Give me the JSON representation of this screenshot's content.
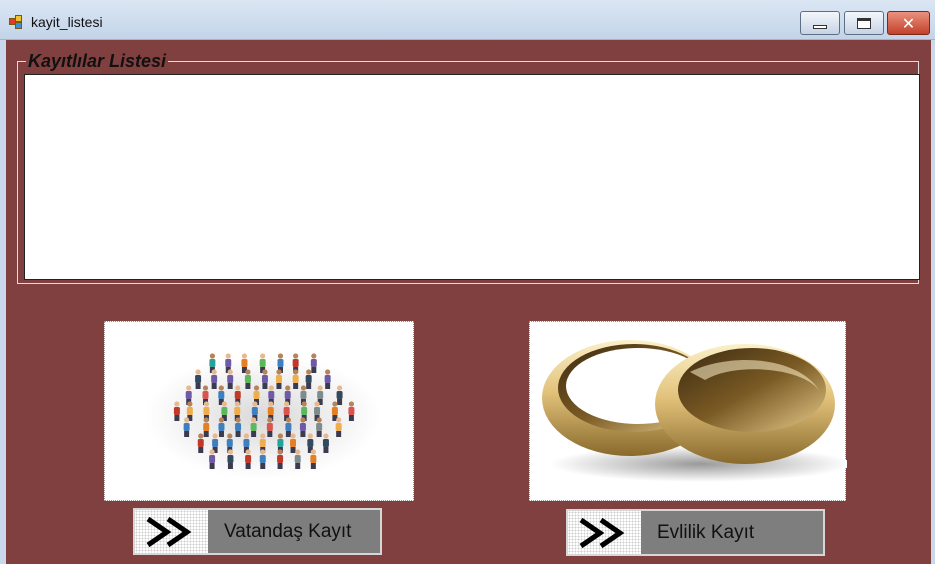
{
  "window": {
    "title": "kayit_listesi",
    "minimize_icon": "minimize-icon",
    "maximize_icon": "maximize-icon",
    "close_icon": "close-icon",
    "close_glyph": "✕"
  },
  "groupbox": {
    "title": "Kayıtlılar Listesi",
    "list_items": []
  },
  "images": [
    {
      "name": "crowd-of-people-image"
    },
    {
      "name": "wedding-rings-image"
    }
  ],
  "buttons": {
    "citizen": {
      "label": "Vatandaş Kayıt",
      "icon": "double-chevron-right-icon"
    },
    "marriage": {
      "label": "Evlilik Kayıt",
      "icon": "double-chevron-right-icon"
    }
  },
  "colors": {
    "form_background": "#814040",
    "button_label_background": "#7e7e7e",
    "list_background": "#ffffff"
  }
}
